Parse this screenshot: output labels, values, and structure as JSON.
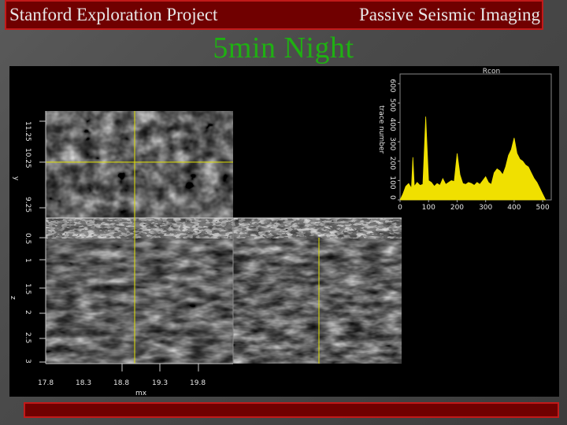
{
  "header": {
    "left_title": "Stanford Exploration Project",
    "right_title": "Passive Seismic Imaging"
  },
  "slide": {
    "title": "5min Night"
  },
  "image_panel": {
    "yaxis_top_labels": [
      "11.25",
      "10.25",
      "9.25"
    ],
    "yaxis_top_title": "y",
    "yaxis_bottom_labels": [
      "0.5",
      "1",
      "1.5",
      "2",
      "2.5",
      "3"
    ],
    "yaxis_bottom_title": "z",
    "xaxis_labels": [
      "17.8",
      "18.3",
      "18.8",
      "19.3",
      "19.8"
    ],
    "xaxis_title": "mx"
  },
  "chart_data": {
    "type": "area",
    "title": "Rcon",
    "xlabel": "",
    "ylabel": "trace number",
    "x_ticks": [
      0,
      100,
      200,
      300,
      400,
      500
    ],
    "y_ticks": [
      0,
      100,
      200,
      300,
      400,
      500,
      600
    ],
    "xlim": [
      0,
      530
    ],
    "ylim": [
      0,
      650
    ],
    "series": [
      {
        "x": [
          0,
          10,
          20,
          30,
          40,
          45,
          50,
          55,
          60,
          70,
          80,
          90,
          100,
          110,
          120,
          130,
          140,
          150,
          160,
          170,
          180,
          190,
          200,
          210,
          220,
          230,
          240,
          250,
          260,
          270,
          280,
          290,
          300,
          310,
          320,
          330,
          340,
          350,
          360,
          370,
          380,
          390,
          400,
          410,
          420,
          430,
          440,
          450,
          460,
          470,
          480,
          490,
          500,
          510
        ],
        "y": [
          0,
          30,
          70,
          85,
          60,
          220,
          70,
          80,
          90,
          75,
          80,
          430,
          100,
          90,
          70,
          85,
          75,
          110,
          80,
          90,
          100,
          95,
          240,
          130,
          85,
          80,
          90,
          85,
          75,
          90,
          80,
          100,
          120,
          90,
          80,
          140,
          160,
          150,
          130,
          170,
          230,
          260,
          320,
          240,
          210,
          200,
          180,
          170,
          140,
          110,
          90,
          60,
          30,
          0
        ]
      }
    ]
  },
  "colors": {
    "accent_red": "#c21a1a",
    "title_green": "#1fb012",
    "crosshair_yellow": "#e0e000"
  }
}
